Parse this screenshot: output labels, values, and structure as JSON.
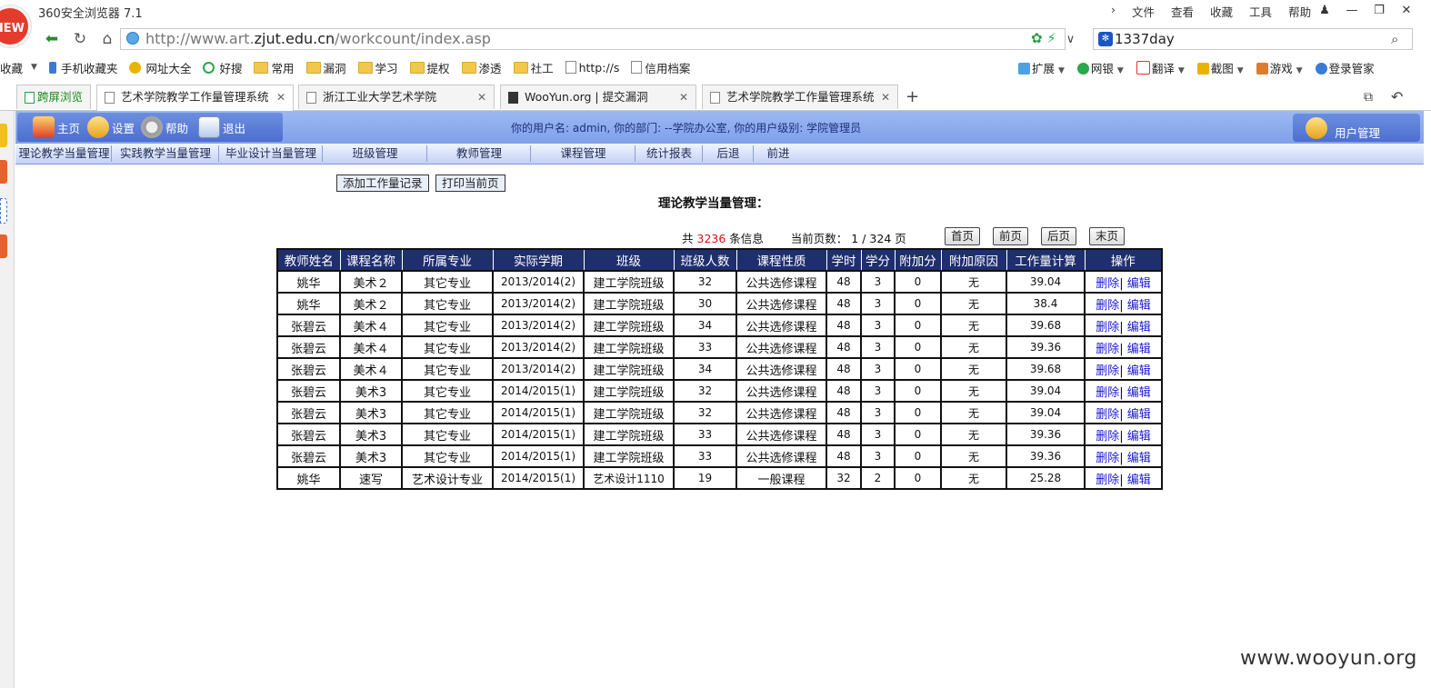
{
  "browser": {
    "logo_text": "IEW",
    "title": "360安全浏览器 7.1",
    "menu": [
      "文件",
      "查看",
      "收藏",
      "工具",
      "帮助"
    ],
    "address": {
      "prefix": "http://www.art.",
      "domain": "zjut.edu.cn",
      "path": "/workcount/index.asp"
    },
    "search_text": "1337day",
    "bookmarks": [
      {
        "label": "收藏",
        "type": "text"
      },
      {
        "label": "手机收藏夹",
        "type": "phone"
      },
      {
        "label": "网址大全",
        "type": "site"
      },
      {
        "label": "好搜",
        "type": "search"
      },
      {
        "label": "常用",
        "type": "folder"
      },
      {
        "label": "漏洞",
        "type": "folder"
      },
      {
        "label": "学习",
        "type": "folder"
      },
      {
        "label": "提权",
        "type": "folder"
      },
      {
        "label": "渗透",
        "type": "folder"
      },
      {
        "label": "社工",
        "type": "folder"
      },
      {
        "label": "http://s",
        "type": "page"
      },
      {
        "label": "信用档案",
        "type": "page"
      }
    ],
    "toolbar_right": [
      "扩展",
      "网银",
      "翻译",
      "截图",
      "游戏",
      "登录管家"
    ],
    "tabs": [
      {
        "label": "跨屏浏览"
      },
      {
        "label": "艺术学院教学工作量管理系统"
      },
      {
        "label": "浙江工业大学艺术学院"
      },
      {
        "label": "WooYun.org | 提交漏洞"
      },
      {
        "label": "艺术学院教学工作量管理系统"
      }
    ]
  },
  "site": {
    "header_buttons": [
      "主页",
      "设置",
      "帮助",
      "退出"
    ],
    "user_info": "你的用户名: admin, 你的部门: --学院办公室, 你的用户级别: 学院管理员",
    "user_mgmt": "用户管理",
    "menu": [
      "理论教学当量管理",
      "实践教学当量管理",
      "毕业设计当量管理",
      "班级管理",
      "教师管理",
      "课程管理",
      "统计报表",
      "后退",
      "前进"
    ]
  },
  "content": {
    "add_button": "添加工作量记录",
    "print_button": "打印当前页",
    "title": "理论教学当量管理：",
    "pager": {
      "prefix": "共",
      "total": "3236",
      "suffix": "条信息",
      "page_label": "当前页数：",
      "page_value": "1 / 324",
      "page_unit": "页",
      "buttons": [
        "首页",
        "前页",
        "后页",
        "末页"
      ]
    },
    "columns": [
      "教师姓名",
      "课程名称",
      "所属专业",
      "实际学期",
      "班级",
      "班级人数",
      "课程性质",
      "学时",
      "学分",
      "附加分",
      "附加原因",
      "工作量计算",
      "操作"
    ],
    "rows": [
      [
        "姚华",
        "美术２",
        "其它专业",
        "2013/2014(2)",
        "建工学院班级",
        "32",
        "公共选修课程",
        "48",
        "3",
        "0",
        "无",
        "39.04"
      ],
      [
        "姚华",
        "美术２",
        "其它专业",
        "2013/2014(2)",
        "建工学院班级",
        "30",
        "公共选修课程",
        "48",
        "3",
        "0",
        "无",
        "38.4"
      ],
      [
        "张碧云",
        "美术４",
        "其它专业",
        "2013/2014(2)",
        "建工学院班级",
        "34",
        "公共选修课程",
        "48",
        "3",
        "0",
        "无",
        "39.68"
      ],
      [
        "张碧云",
        "美术４",
        "其它专业",
        "2013/2014(2)",
        "建工学院班级",
        "33",
        "公共选修课程",
        "48",
        "3",
        "0",
        "无",
        "39.36"
      ],
      [
        "张碧云",
        "美术４",
        "其它专业",
        "2013/2014(2)",
        "建工学院班级",
        "34",
        "公共选修课程",
        "48",
        "3",
        "0",
        "无",
        "39.68"
      ],
      [
        "张碧云",
        "美术3",
        "其它专业",
        "2014/2015(1)",
        "建工学院班级",
        "32",
        "公共选修课程",
        "48",
        "3",
        "0",
        "无",
        "39.04"
      ],
      [
        "张碧云",
        "美术3",
        "其它专业",
        "2014/2015(1)",
        "建工学院班级",
        "32",
        "公共选修课程",
        "48",
        "3",
        "0",
        "无",
        "39.04"
      ],
      [
        "张碧云",
        "美术3",
        "其它专业",
        "2014/2015(1)",
        "建工学院班级",
        "33",
        "公共选修课程",
        "48",
        "3",
        "0",
        "无",
        "39.36"
      ],
      [
        "张碧云",
        "美术3",
        "其它专业",
        "2014/2015(1)",
        "建工学院班级",
        "33",
        "公共选修课程",
        "48",
        "3",
        "0",
        "无",
        "39.36"
      ],
      [
        "姚华",
        "速写",
        "艺术设计专业",
        "2014/2015(1)",
        "艺术设计1110",
        "19",
        "一般课程",
        "32",
        "2",
        "0",
        "无",
        "25.28"
      ]
    ],
    "action_delete": "删除",
    "action_sep": "|",
    "action_edit": "编辑"
  },
  "watermark": "www.wooyun.org"
}
